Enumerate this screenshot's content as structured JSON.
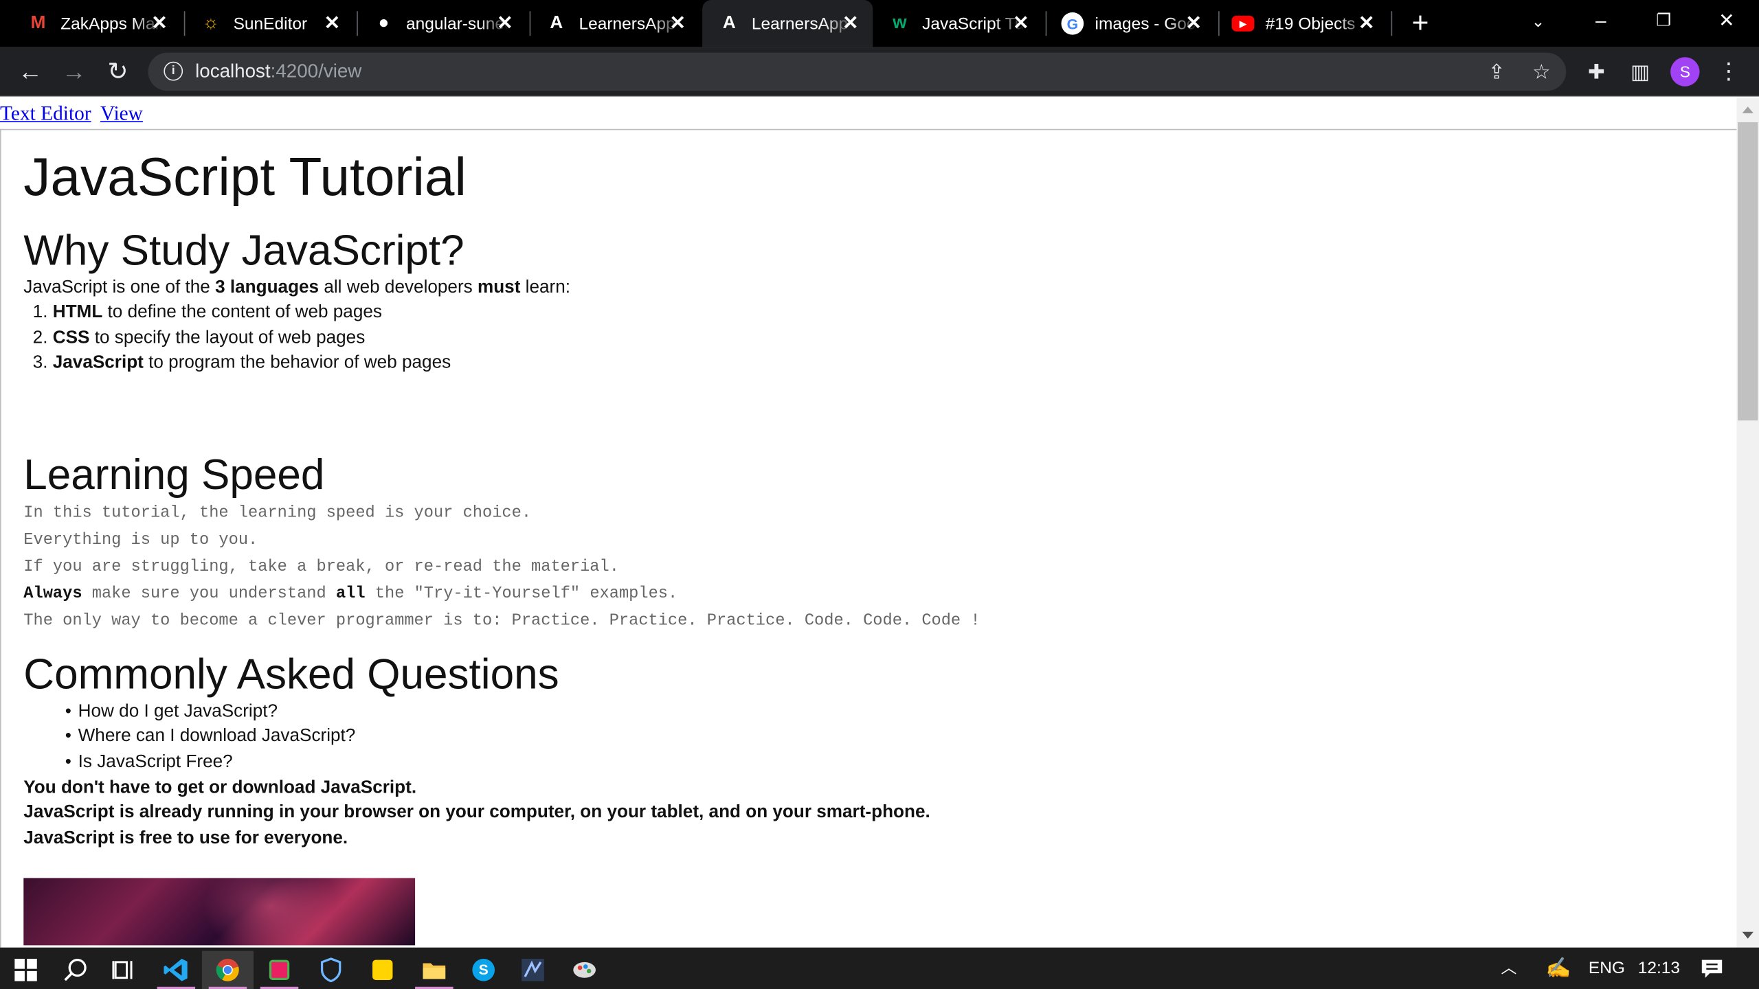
{
  "browser": {
    "tabs": [
      {
        "title": "ZakApps Mail",
        "icon": "gmail-icon",
        "color": "#ea4335",
        "glyph": "M"
      },
      {
        "title": "SunEditor",
        "icon": "suneditor-icon",
        "color": "#f4b400",
        "glyph": "☼"
      },
      {
        "title": "angular-suneditor",
        "icon": "github-icon",
        "color": "#ffffff",
        "glyph": "●"
      },
      {
        "title": "LearnersApp",
        "icon": "angular-icon",
        "color": "#ffffff",
        "glyph": "A"
      },
      {
        "title": "LearnersApp",
        "icon": "angular-icon",
        "color": "#ffffff",
        "glyph": "A"
      },
      {
        "title": "JavaScript Tutorial",
        "icon": "w3schools-icon",
        "color": "#04aa6d",
        "glyph": "w"
      },
      {
        "title": "images - Google",
        "icon": "google-icon",
        "color": "#4285f4",
        "glyph": "G"
      },
      {
        "title": "#19 Objects",
        "icon": "youtube-icon",
        "color": "#ff0000",
        "glyph": "▶"
      }
    ],
    "active_tab": 4,
    "url_host": "localhost",
    "url_rest": ":4200/view"
  },
  "nav": {
    "text_editor": "Text Editor",
    "view": "View"
  },
  "article": {
    "title": "JavaScript Tutorial",
    "why": {
      "heading": "Why Study JavaScript?",
      "intro_1": "JavaScript is one of the ",
      "intro_bold_1": "3 languages",
      "intro_2": " all web developers ",
      "intro_bold_2": "must",
      "intro_3": " learn:",
      "items": [
        {
          "bold": "HTML",
          "text": " to define the content of web pages"
        },
        {
          "bold": "CSS",
          "text": " to specify the layout of web pages"
        },
        {
          "bold": "JavaScript",
          "text": " to program the behavior of web pages"
        }
      ]
    },
    "speed": {
      "heading": "Learning Speed",
      "line_1": "In this tutorial, the learning speed is your choice.",
      "line_2": "Everything is up to you.",
      "line_3": "If you are struggling, take a break, or re-read the material.",
      "line_4_bold_1": "Always",
      "line_4_a": " make sure you understand ",
      "line_4_bold_2": "all",
      "line_4_b": " the \"Try-it-Yourself\" examples.",
      "line_5": "The only way to become a clever programmer is to: Practice. Practice. Practice. Code. Code. Code !"
    },
    "faq": {
      "heading": "Commonly Asked Questions",
      "questions": [
        "How do I get JavaScript?",
        "Where can I download JavaScript?",
        "Is JavaScript Free?"
      ],
      "answers": [
        "You don't have to get or download JavaScript.",
        "JavaScript is already running in your browser on your computer, on your tablet, and on your smart-phone.",
        "JavaScript is free to use for everyone."
      ]
    }
  },
  "taskbar": {
    "apps": [
      "windows-start-icon",
      "search-icon",
      "task-view-icon",
      "vscode-icon",
      "chrome-icon",
      "app-icon",
      "security-icon",
      "sticky-notes-icon",
      "file-explorer-icon",
      "skype-icon",
      "ssms-icon",
      "paint-icon"
    ],
    "language": "ENG",
    "time": "12:13"
  }
}
